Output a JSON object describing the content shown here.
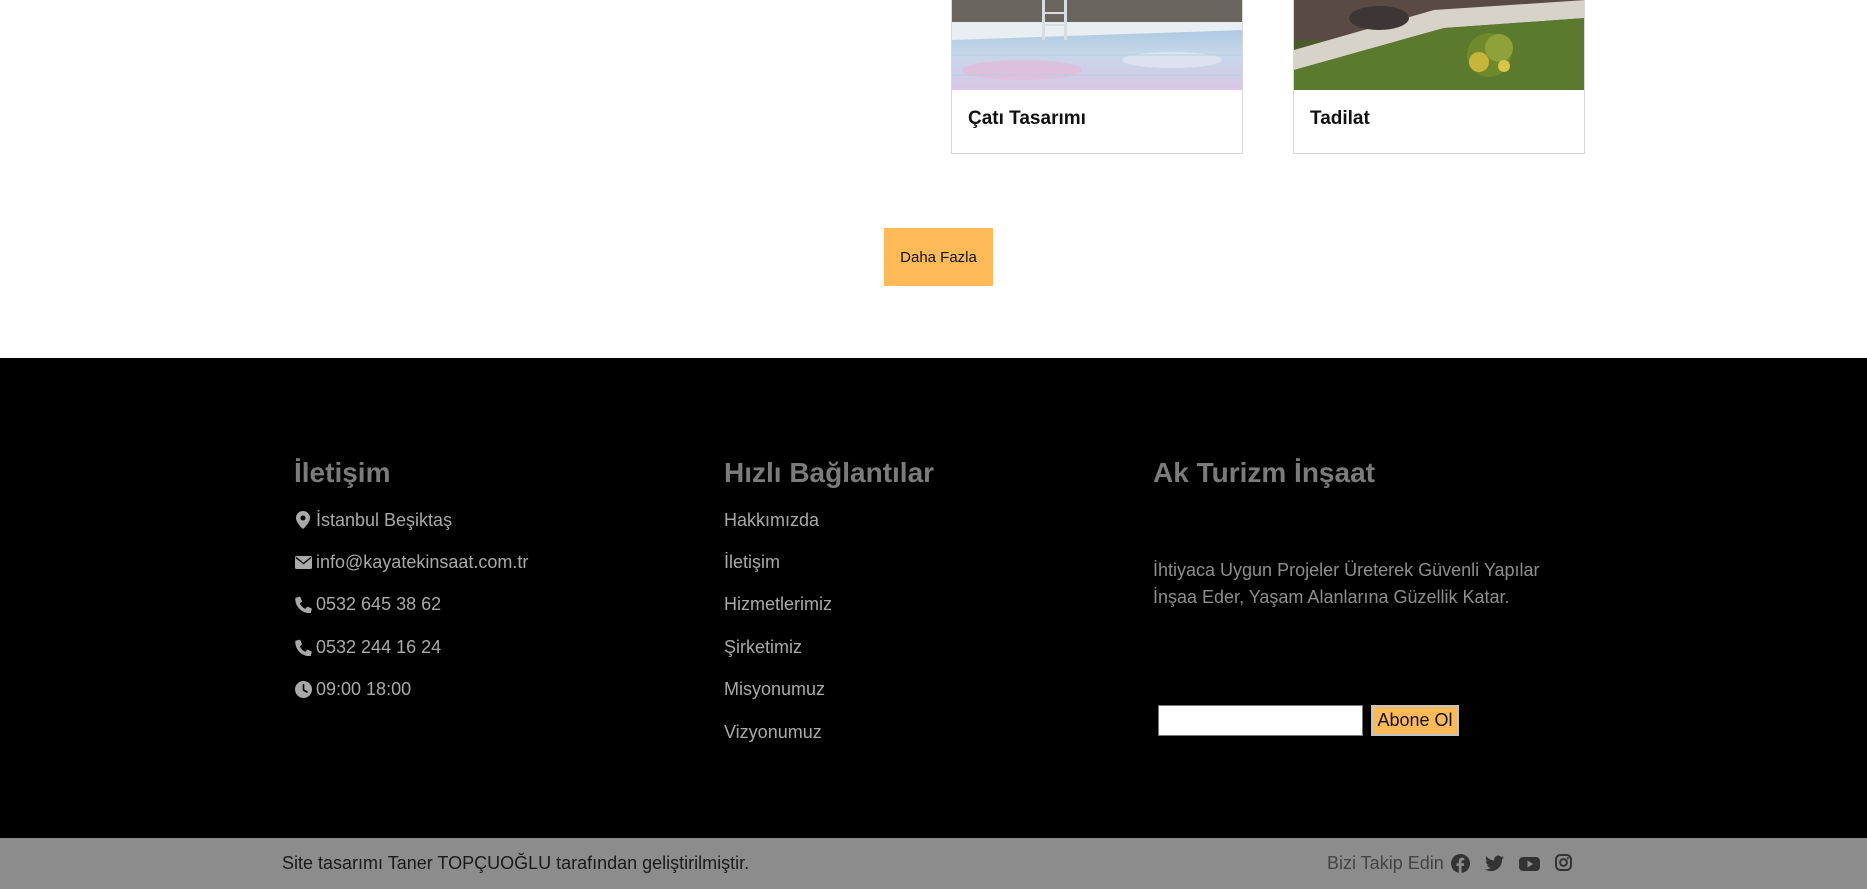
{
  "cards": [
    {
      "title": "Çatı Tasarımı",
      "image": "pool-photo"
    },
    {
      "title": "Tadilat",
      "image": "garden-photo"
    }
  ],
  "more_button": "Daha Fazla",
  "footer": {
    "contact": {
      "heading": "İletişim",
      "items": [
        {
          "icon": "map-marker-icon",
          "text": "İstanbul Beşiktaş"
        },
        {
          "icon": "envelope-icon",
          "text": "info@kayatekinsaat.com.tr"
        },
        {
          "icon": "phone-icon",
          "text": "0532 645 38 62"
        },
        {
          "icon": "phone-icon",
          "text": "0532 244 16 24"
        },
        {
          "icon": "clock-icon",
          "text": "09:00 18:00"
        }
      ]
    },
    "links": {
      "heading": "Hızlı Bağlantılar",
      "items": [
        "Hakkımızda",
        "İletişim",
        "Hizmetlerimiz",
        "Şirketimiz",
        "Misyonumuz",
        "Vizyonumuz"
      ]
    },
    "company": {
      "heading": "Ak Turizm İnşaat",
      "description": "İhtiyaca Uygun Projeler Üreterek Güvenli Yapılar İnşaa Eder, Yaşam Alanlarına Güzellik Katar.",
      "subscribe_button": "Abone Ol",
      "subscribe_value": ""
    }
  },
  "bottom_bar": {
    "credit": "Site tasarımı Taner TOPÇUOĞLU tarafından geliştirilmiştir.",
    "follow_label": "Bizi Takip Edin",
    "social": [
      "facebook-icon",
      "twitter-icon",
      "youtube-icon",
      "instagram-icon"
    ]
  },
  "colors": {
    "accent": "#fdba57",
    "footer_bg": "#000000",
    "bottom_bar_bg": "#8c8c8c",
    "footer_heading": "#7b7b7b",
    "footer_text": "#a9a9a9"
  }
}
